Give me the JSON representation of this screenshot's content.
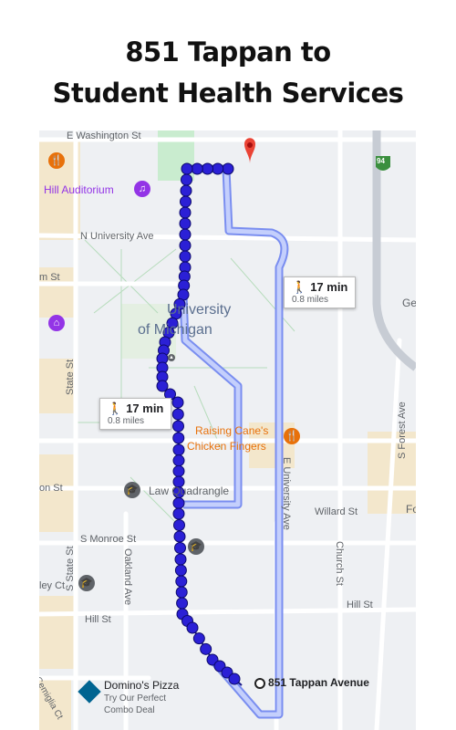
{
  "title_line1": "851 Tappan to",
  "title_line2": "Student Health Services",
  "streets": {
    "e_washington": "E Washington St",
    "n_university": "N University Ave",
    "state_st_left": "m St",
    "state_st_vertical": "State St",
    "s_state": "S State St",
    "oakland": "Oakland Ave",
    "monroe": "S Monroe St",
    "willard": "Willard St",
    "church": "Church St",
    "e_university": "E University Ave",
    "s_forest": "S Forest Ave",
    "hill_left": "Hill St",
    "hill_right": "Hill St",
    "ley_ct": "ley Ct",
    "on_st": "on St",
    "cemiglia": "Cemiglia Ct",
    "geo": "Geo",
    "fo": "Fo"
  },
  "places": {
    "hill_auditorium": "Hill Auditorium",
    "um_line1": "University",
    "um_line2": "of Michigan",
    "raising_canes_line1": "Raising Cane's",
    "raising_canes_line2": "Chicken Fingers",
    "law_quad": "Law Quadrangle",
    "origin": "851 Tappan Avenue",
    "dominos_name": "Domino's Pizza",
    "dominos_sub1": "Try Our Perfect",
    "dominos_sub2": "Combo Deal"
  },
  "highway_shield": "94",
  "routes": [
    {
      "time": "17 min",
      "distance": "0.8 miles",
      "selected": false
    },
    {
      "time": "17 min",
      "distance": "0.8 miles",
      "selected": true
    }
  ],
  "colors": {
    "route_selected": "#2b20d6",
    "route_alt": "#8ca3f5",
    "route_alt_fill": "#c4cffc",
    "destination_pin": "#ea4335",
    "campus_green": "#c9eccf",
    "poi_purple": "#9334e6",
    "poi_orange": "#e8710a",
    "poi_gray": "#5f6368"
  },
  "icons": [
    "walk-icon",
    "destination-pin-icon",
    "music-icon",
    "food-icon",
    "school-icon",
    "museum-icon",
    "pizza-logo-icon",
    "highway-shield-icon",
    "origin-icon"
  ]
}
